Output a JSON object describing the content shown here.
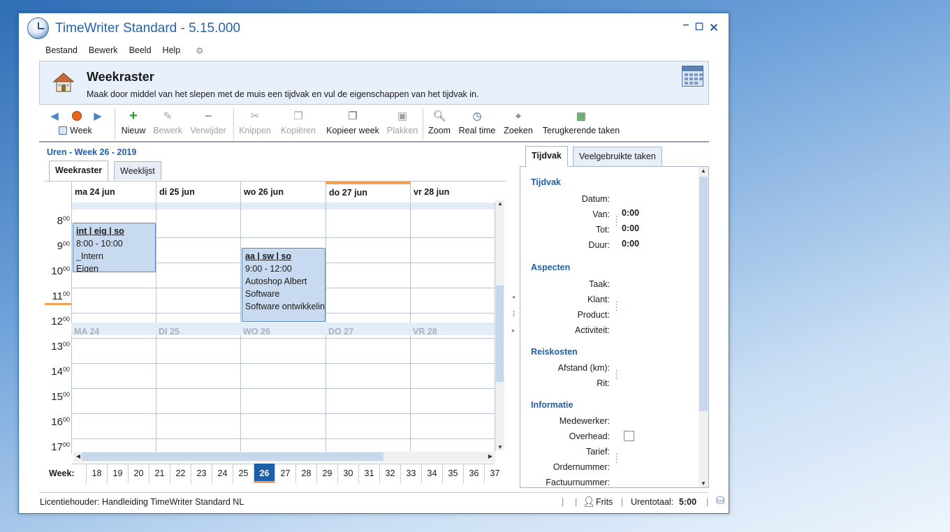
{
  "window": {
    "title": "TimeWriter Standard - 5.15.000",
    "min": "–",
    "max": "☐",
    "close": "✕"
  },
  "menu": [
    "Bestand",
    "Bewerk",
    "Beeld",
    "Help"
  ],
  "header": {
    "title": "Weekraster",
    "subtitle": "Maak door middel van het slepen met de muis een tijdvak en vul de eigenschappen van het tijdvak in."
  },
  "toolbar": {
    "week": "Week",
    "nieuw": "Nieuw",
    "bewerk": "Bewerk",
    "verwijder": "Verwijder",
    "knippen": "Knippen",
    "kopieren": "Kopiëren",
    "kopieer_week": "Kopieer week",
    "plakken": "Plakken",
    "zoom": "Zoom",
    "real_time": "Real time",
    "zoeken": "Zoeken",
    "terugkerende": "Terugkerende taken"
  },
  "period": "Uren - Week 26 - 2019",
  "left_tabs": [
    "Weekraster",
    "Weeklijst"
  ],
  "days": [
    "ma 24 jun",
    "di 25 jun",
    "wo 26 jun",
    "do 27 jun",
    "vr 28 jun"
  ],
  "day_markers": [
    "MA 24",
    "DI 25",
    "WO 26",
    "DO 27",
    "VR 28"
  ],
  "hours": [
    "8",
    "9",
    "10",
    "11",
    "12",
    "13",
    "14",
    "15",
    "16",
    "17"
  ],
  "minutes": "00",
  "events": [
    {
      "header": "int | eig | so",
      "time": "8:00 - 10:00",
      "lines": [
        "_Intern",
        "Eigen"
      ]
    },
    {
      "header": "aa | sw | so",
      "time": "9:00 - 12:00",
      "lines": [
        "Autoshop Albert",
        "Software",
        "Software ontwikkeling"
      ]
    }
  ],
  "week_label": "Week:",
  "weeks": [
    "18",
    "19",
    "20",
    "21",
    "22",
    "23",
    "24",
    "25",
    "26",
    "27",
    "28",
    "29",
    "30",
    "31",
    "32",
    "33",
    "34",
    "35",
    "36",
    "37"
  ],
  "current_week": "26",
  "right_tabs": [
    "Tijdvak",
    "Veelgebruikte taken"
  ],
  "panel": {
    "tijdvak": {
      "title": "Tijdvak",
      "datum": "Datum:",
      "van": "Van:",
      "tot": "Tot:",
      "duur": "Duur:",
      "van_val": "0:00",
      "tot_val": "0:00",
      "duur_val": "0:00"
    },
    "aspecten": {
      "title": "Aspecten",
      "taak": "Taak:",
      "klant": "Klant:",
      "product": "Product:",
      "activiteit": "Activiteit:"
    },
    "reiskosten": {
      "title": "Reiskosten",
      "afstand": "Afstand (km):",
      "rit": "Rit:"
    },
    "informatie": {
      "title": "Informatie",
      "medewerker": "Medewerker:",
      "overhead": "Overhead:",
      "tarief": "Tarief:",
      "ordernummer": "Ordernummer:",
      "factuurnummer": "Factuurnummer:"
    }
  },
  "status": {
    "licentie": "Licentiehouder: Handleiding TimeWriter Standard NL",
    "user": "Frits",
    "urentotaal_label": "Urentotaal:",
    "urentotaal": "5:00"
  }
}
